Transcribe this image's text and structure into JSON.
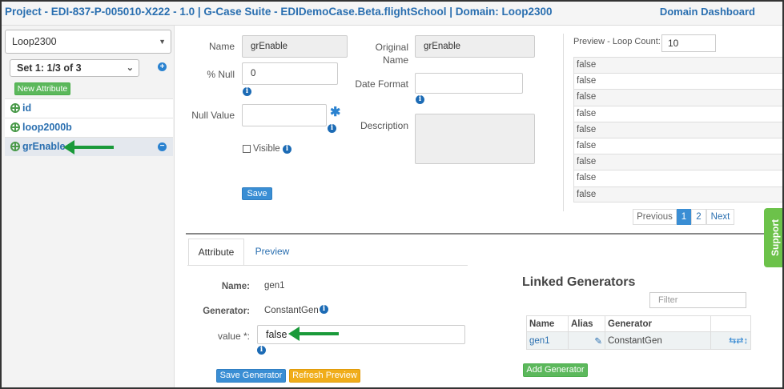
{
  "header": {
    "title": "Project - EDI-837-P-005010-X222 - 1.0 | G-Case Suite - EDIDemoCase.Beta.flightSchool | Domain: Loop2300",
    "dashboard_link": "Domain Dashboard"
  },
  "sidebar": {
    "domain_select": "Loop2300",
    "set_select": "Set 1: 1/3 of 3",
    "new_attribute": "New Attribute",
    "attributes": [
      {
        "label": "id"
      },
      {
        "label": "loop2000b"
      },
      {
        "label": "grEnable",
        "selected": true
      }
    ]
  },
  "form": {
    "name_label": "Name",
    "name_value": "grEnable",
    "null_pct_label": "% Null",
    "null_pct_value": "0",
    "null_value_label": "Null Value",
    "visible_label": "Visible",
    "save_label": "Save",
    "original_name_label_1": "Original",
    "original_name_label_2": "Name",
    "original_name_value": "grEnable",
    "date_format_label": "Date Format",
    "description_label": "Description"
  },
  "preview": {
    "label": "Preview - Loop Count:",
    "loop_count": "10",
    "rows": [
      "false",
      "false",
      "false",
      "false",
      "false",
      "false",
      "false",
      "false",
      "false"
    ],
    "pager": {
      "previous": "Previous",
      "page1": "1",
      "page2": "2",
      "next": "Next"
    }
  },
  "tabs": [
    {
      "label": "Attribute",
      "active": true
    },
    {
      "label": "Preview",
      "active": false
    }
  ],
  "generator_form": {
    "name_label": "Name:",
    "name_value": "gen1",
    "generator_label": "Generator:",
    "generator_value": "ConstantGen",
    "value_label": "value *:",
    "value_value": "false",
    "save_generator": "Save Generator",
    "refresh_preview": "Refresh Preview"
  },
  "linked_generators": {
    "title": "Linked Generators",
    "filter_placeholder": "Filter",
    "headers": [
      "Name",
      "Alias",
      "Generator"
    ],
    "rows": [
      {
        "name": "gen1",
        "alias": "",
        "generator": "ConstantGen"
      }
    ],
    "add_generator": "Add Generator"
  },
  "support_label": "Support",
  "colors": {
    "accent": "#2a6fb0",
    "green": "#5cb85c",
    "arrow": "#1a9a3a",
    "orange": "#f0ad1a"
  }
}
